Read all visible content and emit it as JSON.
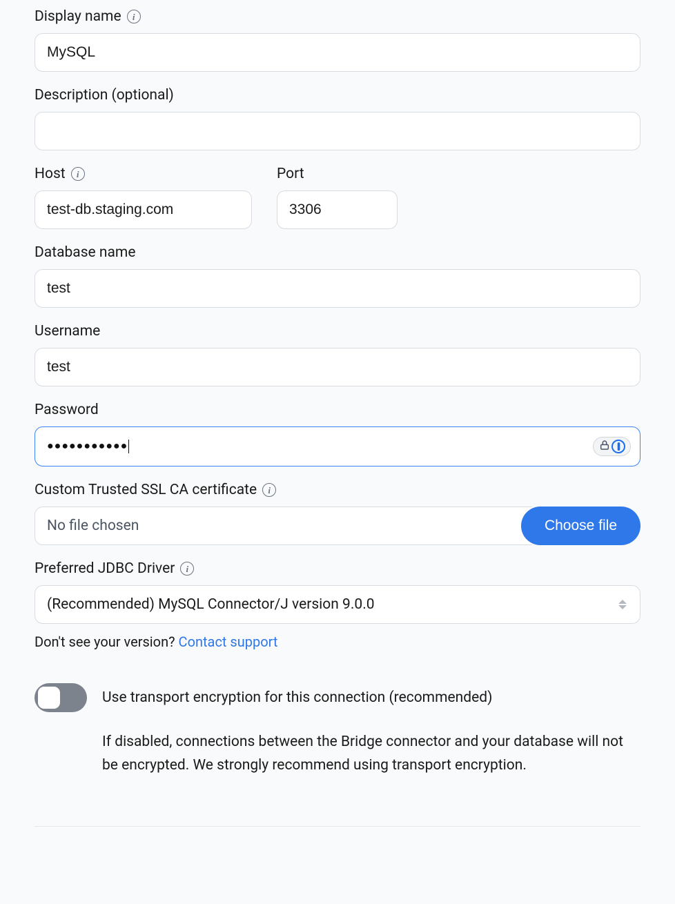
{
  "display_name": {
    "label": "Display name",
    "value": "MySQL"
  },
  "description": {
    "label": "Description (optional)",
    "value": ""
  },
  "host": {
    "label": "Host",
    "value": "test-db.staging.com"
  },
  "port": {
    "label": "Port",
    "value": "3306"
  },
  "database_name": {
    "label": "Database name",
    "value": "test"
  },
  "username": {
    "label": "Username",
    "value": "test"
  },
  "password": {
    "label": "Password",
    "value": "●●●●●●●●●●●"
  },
  "ssl_cert": {
    "label": "Custom Trusted SSL CA certificate",
    "file_text": "No file chosen",
    "button": "Choose file"
  },
  "jdbc": {
    "label": "Preferred JDBC Driver",
    "selected": "(Recommended) MySQL Connector/J version 9.0.0"
  },
  "version_helper": {
    "text": "Don't see your version? ",
    "link": "Contact support"
  },
  "encryption": {
    "label": "Use transport encryption for this connection (recommended)",
    "desc": "If disabled, connections between the Bridge connector and your database will not be encrypted. We strongly recommend using transport encryption.",
    "enabled": false
  }
}
